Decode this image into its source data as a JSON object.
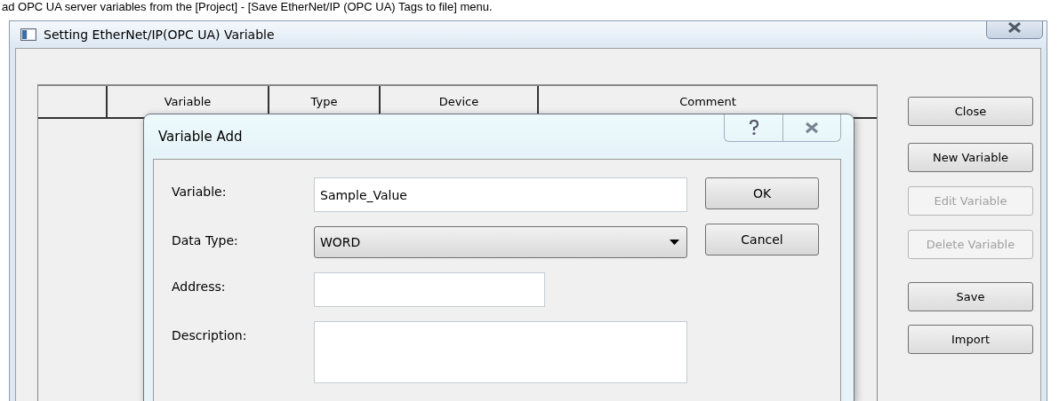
{
  "caption": "ad OPC UA server variables from the [Project] - [Save EtherNet/IP (OPC UA) Tags to file] menu.",
  "window": {
    "title": "Setting EtherNet/IP(OPC UA) Variable"
  },
  "table": {
    "columns": [
      "",
      "Variable",
      "Type",
      "Device",
      "Comment"
    ]
  },
  "buttons": [
    {
      "label": "Close",
      "disabled": false
    },
    {
      "label": "New Variable",
      "disabled": false
    },
    {
      "label": "Edit Variable",
      "disabled": true
    },
    {
      "label": "Delete Variable",
      "disabled": true
    },
    {
      "label": "Save",
      "disabled": false
    },
    {
      "label": "Import",
      "disabled": false
    }
  ],
  "dialog": {
    "title": "Variable Add",
    "fields": [
      {
        "kind": "text",
        "label": "Variable:",
        "value": "Sample_Value"
      },
      {
        "kind": "select",
        "label": "Data Type:",
        "value": "WORD"
      },
      {
        "kind": "short",
        "label": "Address:"
      },
      {
        "kind": "area",
        "label": "Description:"
      }
    ],
    "buttons": [
      "OK",
      "Cancel"
    ]
  }
}
